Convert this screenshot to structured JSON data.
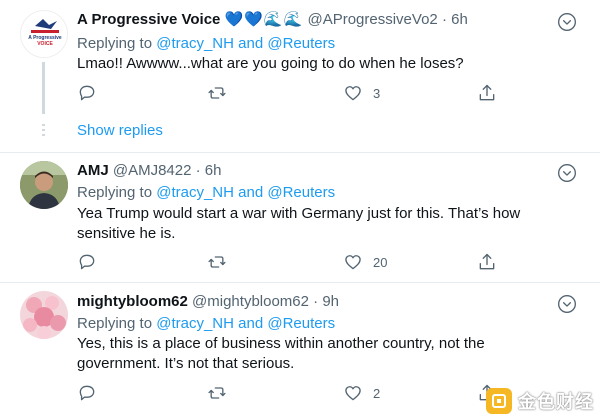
{
  "tweets": [
    {
      "name": "A Progressive Voice",
      "hearts": "💙💙🌊🌊",
      "handle": "@AProgressiveVo2",
      "sep": "·",
      "time": "6h",
      "replying_prefix": "Replying to",
      "reply_to_1": "@tracy_NH",
      "reply_and": "and",
      "reply_to_2": "@Reuters",
      "text": "Lmao!! Awwww...what are you going to do when he loses?",
      "likes": "3",
      "avatar_text": "A Progressive VOICE"
    },
    {
      "name": "AMJ",
      "handle": "@AMJ8422",
      "sep": "·",
      "time": "6h",
      "replying_prefix": "Replying to",
      "reply_to_1": "@tracy_NH",
      "reply_and": "and",
      "reply_to_2": "@Reuters",
      "text": "Yea Trump would start a war with Germany just for this. That’s how sensitive he is.",
      "likes": "20"
    },
    {
      "name": "mightybloom62",
      "handle": "@mightybloom62",
      "sep": "·",
      "time": "9h",
      "replying_prefix": "Replying to",
      "reply_to_1": "@tracy_NH",
      "reply_and": "and",
      "reply_to_2": "@Reuters",
      "text": "Yes, this is a place of business within another country, not the government. It’s not that serious.",
      "likes": "2"
    }
  ],
  "show_replies": "Show replies",
  "watermark": "金色财经",
  "colors": {
    "accent": "#1d9bf0",
    "muted": "#536471",
    "divider": "#e6ecf0"
  },
  "icons": [
    "reply-icon",
    "retweet-icon",
    "like-icon",
    "share-icon",
    "more-icon"
  ]
}
